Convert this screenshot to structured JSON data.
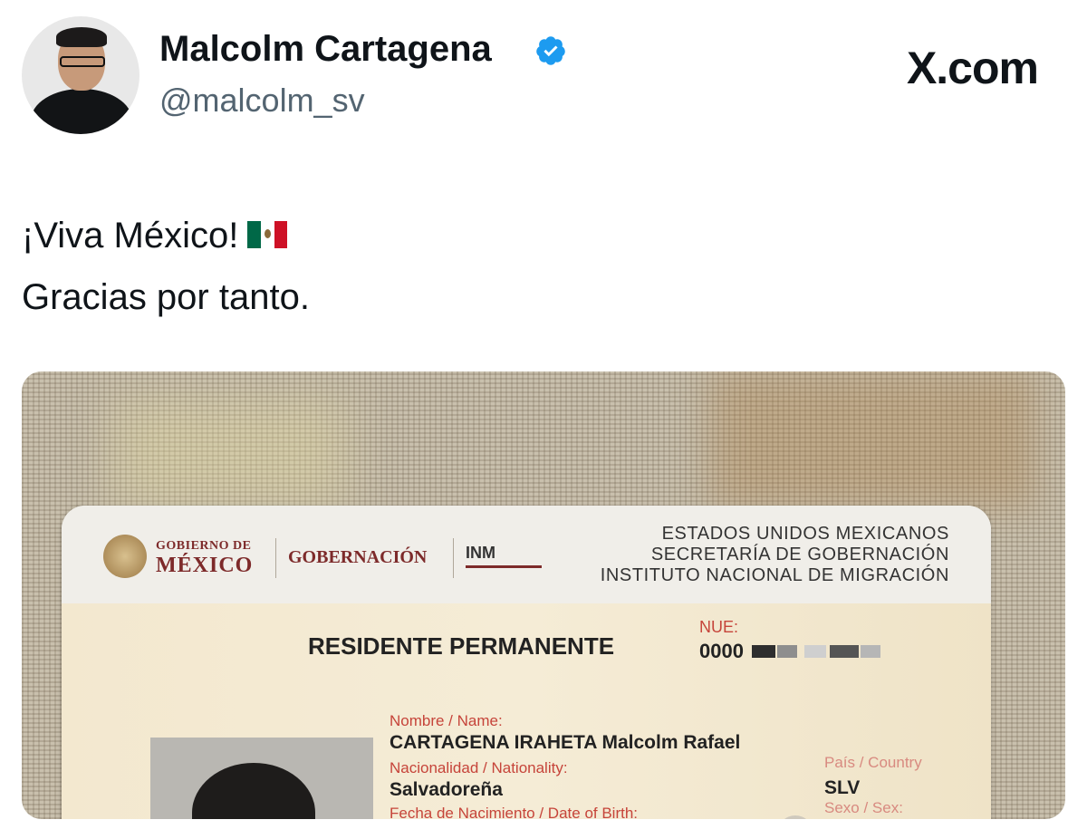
{
  "tweet": {
    "author": {
      "display_name": "Malcolm Cartagena",
      "handle": "@malcolm_sv",
      "verified": true
    },
    "source_watermark": "X.com",
    "text_lines": [
      "¡Viva México!",
      "Gracias por tanto."
    ],
    "emoji": "mexico-flag"
  },
  "id_card": {
    "header_left": {
      "gob_line1": "GOBIERNO DE",
      "gob_line2": "MÉXICO",
      "secretaria": "GOBERNACIÓN",
      "inm": "INM"
    },
    "header_right": [
      "ESTADOS UNIDOS MEXICANOS",
      "SECRETARÍA DE GOBERNACIÓN",
      "INSTITUTO NACIONAL DE MIGRACIÓN"
    ],
    "document_type": "RESIDENTE PERMANENTE",
    "nue_label": "NUE:",
    "nue_value": "0000",
    "name_label": "Nombre / Name:",
    "name_value": "CARTAGENA IRAHETA Malcolm Rafael",
    "nationality_label": "Nacionalidad / Nationality:",
    "nationality_value": "Salvadoreña",
    "country_label": "País / Country",
    "country_value": "SLV",
    "dob_label": "Fecha de Nacimiento / Date of Birth:",
    "sex_label": "Sexo / Sex:"
  },
  "colors": {
    "text": "#0f1419",
    "secondary_text": "#536471",
    "verified_blue": "#1d9bf0",
    "card_red": "#c6443a",
    "gov_maroon": "#7d2a2a"
  }
}
